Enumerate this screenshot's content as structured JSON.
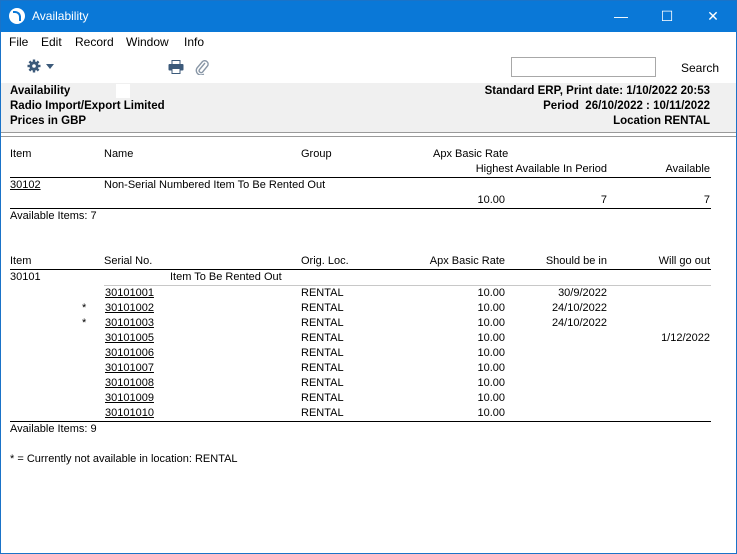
{
  "window": {
    "title": "Availability",
    "minimize": "—",
    "maximize": "☐",
    "close": "✕"
  },
  "menu": [
    "File",
    "Edit",
    "Record",
    "Window",
    "Info"
  ],
  "toolbar": {
    "search_label": "Search",
    "search_value": ""
  },
  "header": {
    "title": "Availability",
    "company": "Radio Import/Export Limited",
    "prices": "Prices in GBP",
    "print_info": "Standard ERP, Print date: 1/10/2022 20:53",
    "period": "Period  26/10/2022 : 10/11/2022",
    "location": "Location RENTAL"
  },
  "section1": {
    "col_item": "Item",
    "col_name": "Name",
    "col_group": "Group",
    "col_rate": "Apx Basic Rate",
    "col_highest": "Highest Available In Period",
    "col_available": "Available",
    "row": {
      "item": "30102",
      "name": "Non-Serial Numbered Item To Be Rented Out",
      "rate": "10.00",
      "highest": "7",
      "available": "7"
    },
    "footer": "Available Items: 7"
  },
  "section2": {
    "col_item": "Item",
    "col_serial": "Serial No.",
    "col_loc": "Orig. Loc.",
    "col_rate": "Apx Basic Rate",
    "col_should": "Should be in",
    "col_out": "Will go out",
    "item": "30101",
    "item_name": "Item To Be Rented Out",
    "rows": [
      {
        "mark": "",
        "serial": "30101001",
        "loc": "RENTAL",
        "rate": "10.00",
        "should": "30/9/2022",
        "out": ""
      },
      {
        "mark": "*",
        "serial": "30101002",
        "loc": "RENTAL",
        "rate": "10.00",
        "should": "24/10/2022",
        "out": ""
      },
      {
        "mark": "*",
        "serial": "30101003",
        "loc": "RENTAL",
        "rate": "10.00",
        "should": "24/10/2022",
        "out": ""
      },
      {
        "mark": "",
        "serial": "30101005",
        "loc": "RENTAL",
        "rate": "10.00",
        "should": "",
        "out": "1/12/2022"
      },
      {
        "mark": "",
        "serial": "30101006",
        "loc": "RENTAL",
        "rate": "10.00",
        "should": "",
        "out": ""
      },
      {
        "mark": "",
        "serial": "30101007",
        "loc": "RENTAL",
        "rate": "10.00",
        "should": "",
        "out": ""
      },
      {
        "mark": "",
        "serial": "30101008",
        "loc": "RENTAL",
        "rate": "10.00",
        "should": "",
        "out": ""
      },
      {
        "mark": "",
        "serial": "30101009",
        "loc": "RENTAL",
        "rate": "10.00",
        "should": "",
        "out": ""
      },
      {
        "mark": "",
        "serial": "30101010",
        "loc": "RENTAL",
        "rate": "10.00",
        "should": "",
        "out": ""
      }
    ],
    "footer": "Available Items: 9"
  },
  "note": "* = Currently not available in location: RENTAL"
}
